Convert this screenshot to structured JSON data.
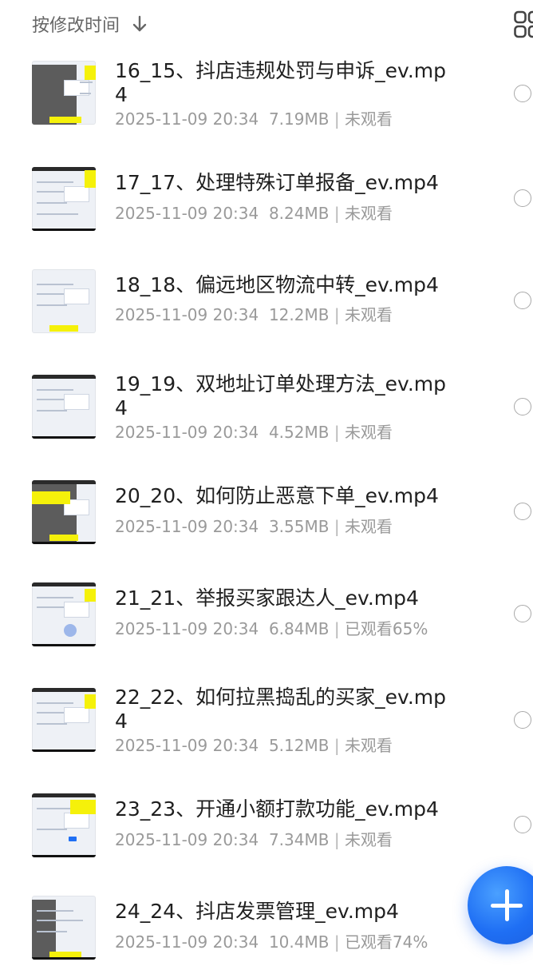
{
  "sort": {
    "label": "按修改时间",
    "direction_icon": "arrow-down-icon"
  },
  "view_toggle_icon": "grid-view-icon",
  "files": [
    {
      "name": "16_15、抖店违规处罚与申诉_ev.mp4",
      "date": "2025-11-09 20:34",
      "size": "7.19MB",
      "status": "未观看"
    },
    {
      "name": "17_17、处理特殊订单报备_ev.mp4",
      "date": "2025-11-09 20:34",
      "size": "8.24MB",
      "status": "未观看"
    },
    {
      "name": "18_18、偏远地区物流中转_ev.mp4",
      "date": "2025-11-09 20:34",
      "size": "12.2MB",
      "status": "未观看"
    },
    {
      "name": "19_19、双地址订单处理方法_ev.mp4",
      "date": "2025-11-09 20:34",
      "size": "4.52MB",
      "status": "未观看"
    },
    {
      "name": "20_20、如何防止恶意下单_ev.mp4",
      "date": "2025-11-09 20:34",
      "size": "3.55MB",
      "status": "未观看"
    },
    {
      "name": "21_21、举报买家跟达人_ev.mp4",
      "date": "2025-11-09 20:34",
      "size": "6.84MB",
      "status": "已观看65%"
    },
    {
      "name": "22_22、如何拉黑捣乱的买家_ev.mp4",
      "date": "2025-11-09 20:34",
      "size": "5.12MB",
      "status": "未观看"
    },
    {
      "name": "23_23、开通小额打款功能_ev.mp4",
      "date": "2025-11-09 20:34",
      "size": "7.34MB",
      "status": "未观看"
    },
    {
      "name": "24_24、抖店发票管理_ev.mp4",
      "date": "2025-11-09 20:34",
      "size": "10.4MB",
      "status": "已观看74%"
    }
  ],
  "meta_separator": "|",
  "fab_icon": "plus-icon",
  "colors": {
    "accent": "#1f6ff4",
    "text_primary": "#1f1f1f",
    "text_secondary": "#9a9a9a"
  }
}
